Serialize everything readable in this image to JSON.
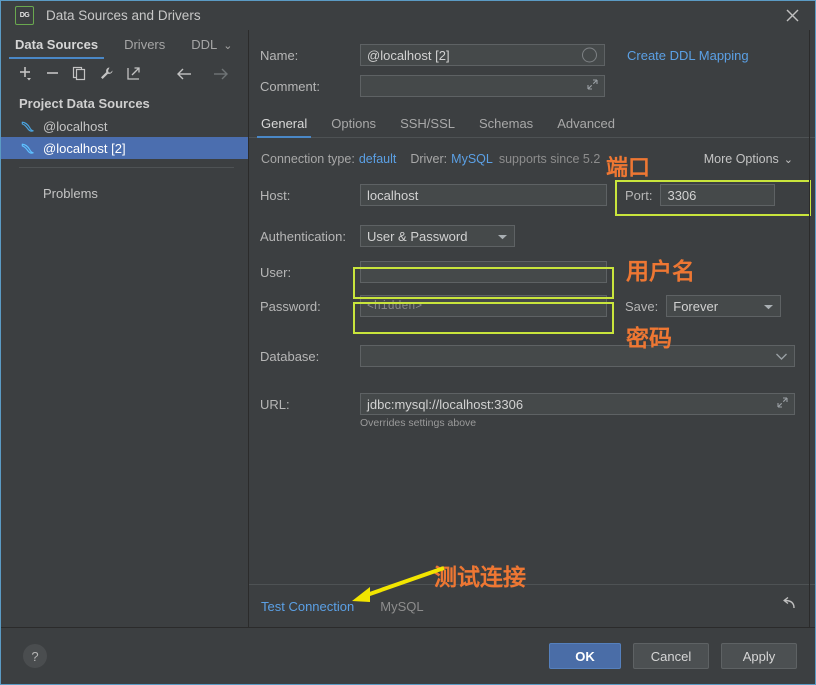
{
  "window": {
    "title": "Data Sources and Drivers",
    "app_icon_text": "DG",
    "close_icon": "close-icon"
  },
  "sidebar": {
    "tabs": [
      {
        "label": "Data Sources",
        "active": true
      },
      {
        "label": "Drivers",
        "active": false
      },
      {
        "label": "DDL",
        "active": false
      }
    ],
    "tab_overflow_chevron": "⌄",
    "toolbar": [
      {
        "name": "add-button",
        "glyph": "+"
      },
      {
        "name": "remove-button",
        "glyph": "−"
      },
      {
        "name": "copy-button",
        "glyph": "⧉"
      },
      {
        "name": "properties-button",
        "glyph": "⚒"
      },
      {
        "name": "jump-to-button",
        "glyph": "↗"
      },
      {
        "name": "back-button",
        "glyph": "←"
      },
      {
        "name": "forward-button",
        "glyph": "→"
      }
    ],
    "group_header": "Project Data Sources",
    "items": [
      {
        "label": "@localhost",
        "selected": false
      },
      {
        "label": "@localhost [2]",
        "selected": true
      }
    ],
    "problems_label": "Problems"
  },
  "main": {
    "name_label": "Name:",
    "name_value": "@localhost [2]",
    "create_ddl_mapping": "Create DDL Mapping",
    "comment_label": "Comment:",
    "comment_value": "",
    "tabs": [
      {
        "label": "General",
        "active": true
      },
      {
        "label": "Options",
        "active": false
      },
      {
        "label": "SSH/SSL",
        "active": false
      },
      {
        "label": "Schemas",
        "active": false
      },
      {
        "label": "Advanced",
        "active": false
      }
    ],
    "connection_type_label": "Connection type:",
    "connection_type_value": "default",
    "driver_label": "Driver:",
    "driver_value": "MySQL",
    "driver_note": "supports since 5.2",
    "more_options": "More Options",
    "more_options_chevron": "⌄",
    "host_label": "Host:",
    "host_value": "localhost",
    "port_label": "Port:",
    "port_value": "3306",
    "auth_label": "Authentication:",
    "auth_value": "User & Password",
    "user_label": "User:",
    "user_value": "",
    "password_label": "Password:",
    "password_placeholder": "<hidden>",
    "save_label": "Save:",
    "save_value": "Forever",
    "database_label": "Database:",
    "database_value": "",
    "url_label": "URL:",
    "url_value": "jdbc:mysql://localhost:3306",
    "url_hint": "Overrides settings above",
    "test_connection": "Test Connection",
    "driver_footer": "MySQL",
    "revert_icon": "revert-icon"
  },
  "annotations": {
    "port": "端口",
    "user": "用户名",
    "password": "密码",
    "test_connection": "测试连接",
    "color": "#ee7733",
    "highlight_color": "#c9e53c",
    "arrow_color": "#f2e500"
  },
  "bottom": {
    "help_label": "?",
    "ok": "OK",
    "cancel": "Cancel",
    "apply": "Apply"
  }
}
